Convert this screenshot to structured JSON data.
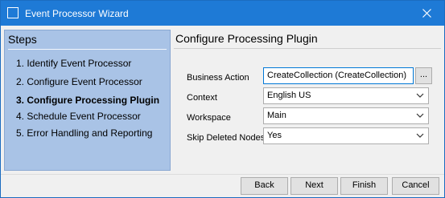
{
  "window": {
    "title": "Event Processor Wizard",
    "close_icon": "close-icon",
    "accent_color": "#1e7ad6"
  },
  "steps": {
    "title": "Steps",
    "items": [
      {
        "label": "1. Identify Event Processor",
        "active": false
      },
      {
        "label": "2. Configure Event Processor",
        "active": false
      },
      {
        "label": "3. Configure Processing Plugin",
        "active": true
      },
      {
        "label": "4. Schedule Event Processor",
        "active": false
      },
      {
        "label": "5. Error Handling and Reporting",
        "active": false
      }
    ],
    "background_color": "#a9c3e6"
  },
  "main": {
    "title": "Configure Processing Plugin",
    "fields": {
      "business_action": {
        "label": "Business Action",
        "value": "CreateCollection (CreateCollection)",
        "browse_label": "..."
      },
      "context": {
        "label": "Context",
        "value": "English US"
      },
      "workspace": {
        "label": "Workspace",
        "value": "Main"
      },
      "skip_deleted_nodes": {
        "label": "Skip Deleted Nodes",
        "value": "Yes"
      }
    }
  },
  "footer": {
    "back_label": "Back",
    "next_label": "Next",
    "finish_label": "Finish",
    "cancel_label": "Cancel"
  }
}
